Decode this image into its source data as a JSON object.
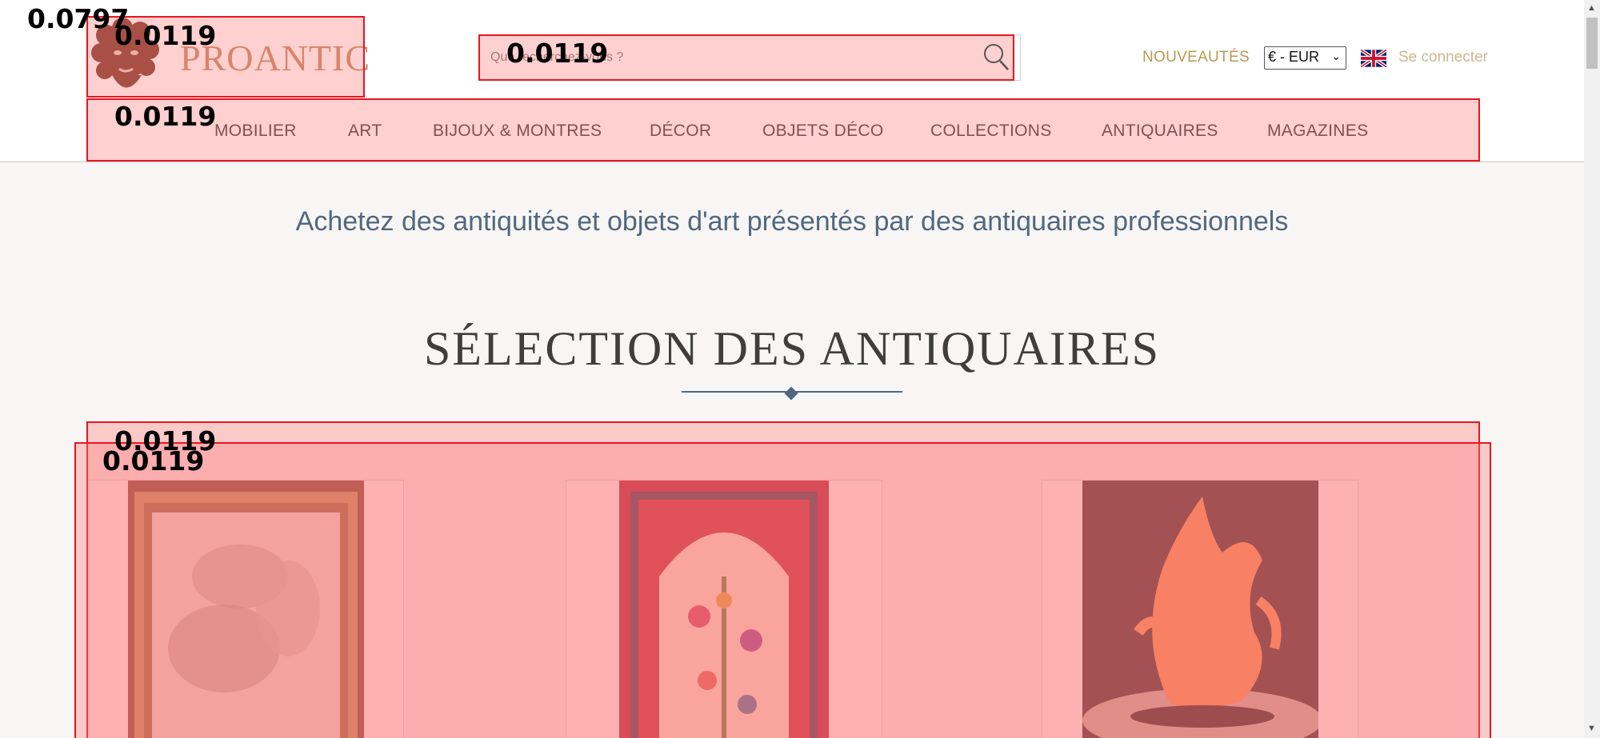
{
  "header": {
    "logo_text": "PROANTIC",
    "search_placeholder": "Que recherchez-vous ?",
    "nouveautes": "NOUVEAUTÉS",
    "currency": "€ - EUR",
    "login": "Se connecter"
  },
  "nav": {
    "items": [
      "MOBILIER",
      "ART",
      "BIJOUX & MONTRES",
      "DÉCOR",
      "OBJETS DÉCO",
      "COLLECTIONS",
      "ANTIQUAIRES",
      "MAGAZINES"
    ]
  },
  "main": {
    "tagline": "Achetez des antiquités et objets d'art présentés par des antiquaires professionnels",
    "section_title": "SÉLECTION DES ANTIQUAIRES"
  },
  "overlay": {
    "scores": [
      "0.0797",
      "0.0119",
      "0.0119",
      "0.0119",
      "0.0119",
      "0.0119"
    ]
  },
  "colors": {
    "logo": "#c58a63",
    "gold": "#b99a52",
    "tagline": "#52677f",
    "overlay": "#e8161e"
  }
}
